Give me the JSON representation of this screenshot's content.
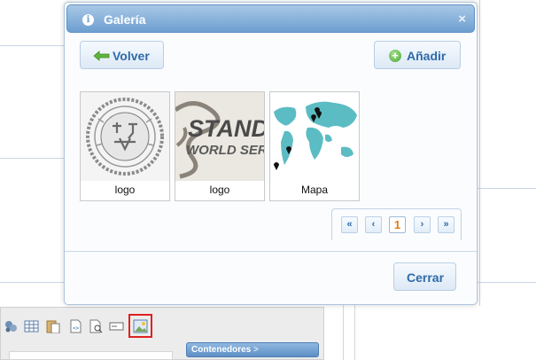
{
  "dialog": {
    "title": "Galería",
    "info_icon": "info-icon",
    "close_icon": "close-icon",
    "close_glyph": "×"
  },
  "buttons": {
    "back_label": "Volver",
    "add_label": "Añadir",
    "close_label": "Cerrar"
  },
  "gallery": {
    "items": [
      {
        "caption": "logo",
        "image": "seal-logo-thumbnail"
      },
      {
        "caption": "logo",
        "image": "standard-world-series-logo-thumbnail"
      },
      {
        "caption": "Mapa",
        "image": "world-map-with-pins-thumbnail"
      }
    ]
  },
  "pagination": {
    "first": "«",
    "prev": "‹",
    "current_page": "1",
    "next": "›",
    "last": "»"
  },
  "background": {
    "toolbar_icons": [
      "special-chars-icon",
      "table-icon",
      "paste-icon",
      "source-icon",
      "preview-icon",
      "textbox-icon",
      "image-gallery-icon"
    ],
    "panel_title": "Contenedores",
    "panel_arrow": ">"
  },
  "colors": {
    "header": "#6d9fd0",
    "button_text": "#2e6aa8",
    "current_page": "#e07a12",
    "selected_outline": "#e02020"
  }
}
